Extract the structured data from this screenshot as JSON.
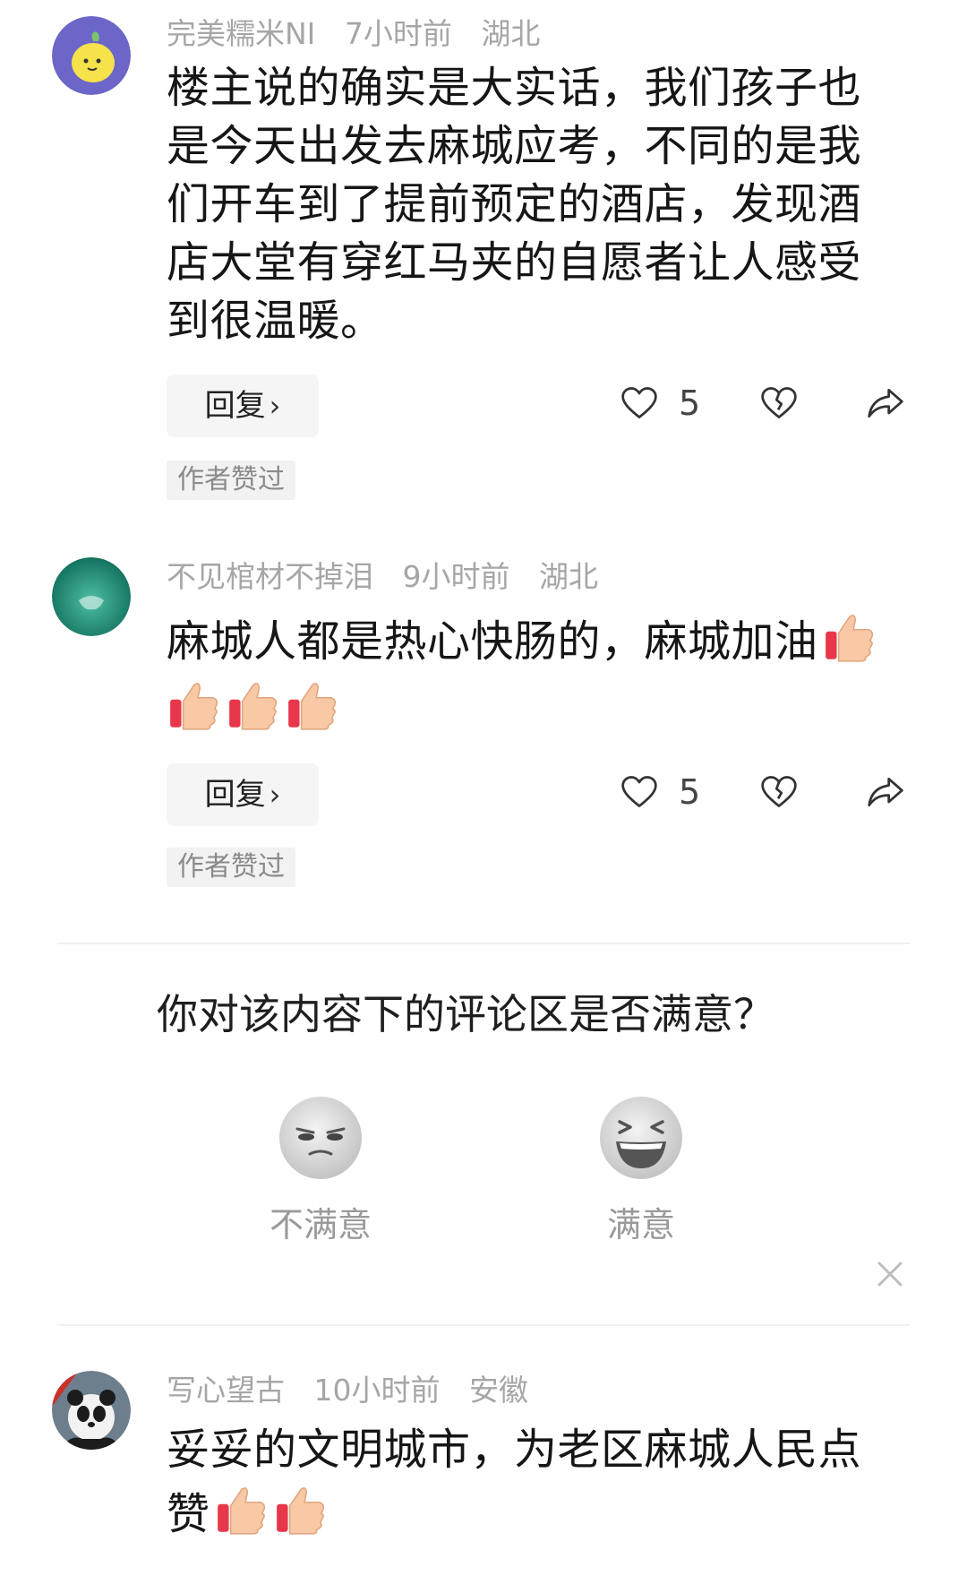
{
  "comments": [
    {
      "username": "完美糯米NI",
      "time": "7小时前",
      "location": "湖北",
      "text": "楼主说的确实是大实话，我们孩子也是今天出发去麻城应考，不同的是我们开车到了提前预定的酒店，发现酒店大堂有穿红马夹的自愿者让人感受到很温暖。",
      "reply_label": "回复",
      "likes": "5",
      "author_liked": "作者赞过",
      "avatar_icon": "lemon-avatar"
    },
    {
      "username": "不见棺材不掉泪",
      "time": "9小时前",
      "location": "湖北",
      "text": "麻城人都是热心快肠的，麻城加油",
      "thumbs_inline": 1,
      "thumbs_after": 3,
      "reply_label": "回复",
      "likes": "5",
      "author_liked": "作者赞过",
      "avatar_icon": "teal-avatar"
    },
    {
      "username": "写心望古",
      "time": "10小时前",
      "location": "安徽",
      "text": "妥妥的文明城市，为老区麻城人民点赞",
      "thumbs_after": 2,
      "avatar_icon": "panda-avatar"
    }
  ],
  "survey": {
    "question": "你对该内容下的评论区是否满意？",
    "options": [
      {
        "label": "不满意",
        "icon": "unamused-face-icon"
      },
      {
        "label": "满意",
        "icon": "laughing-face-icon"
      }
    ],
    "close_icon": "close-icon"
  },
  "colors": {
    "meta_gray": "#a6a6a6",
    "text": "#161616",
    "button_bg": "#f5f5f5",
    "divider": "#f1f1f1"
  }
}
